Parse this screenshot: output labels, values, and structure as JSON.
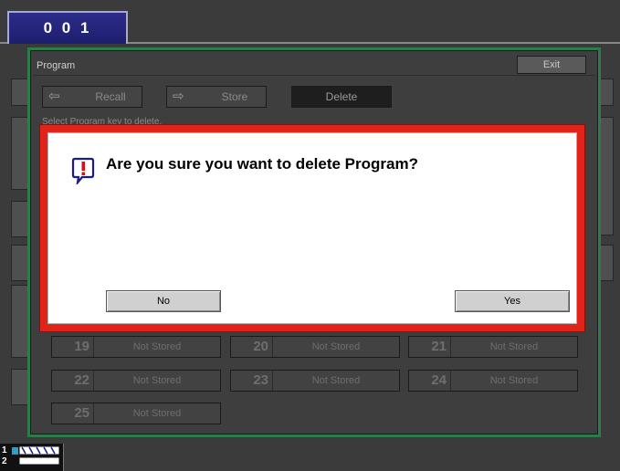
{
  "tab": {
    "label": "0 0 1"
  },
  "program_window": {
    "title": "Program",
    "exit_label": "Exit",
    "toolbar": {
      "recall_label": "Recall",
      "store_label": "Store",
      "delete_label": "Delete"
    },
    "select_label": "Select Program key to delete."
  },
  "slots": [
    {
      "number": "19",
      "status": "Not Stored"
    },
    {
      "number": "20",
      "status": "Not Stored"
    },
    {
      "number": "21",
      "status": "Not Stored"
    },
    {
      "number": "22",
      "status": "Not Stored"
    },
    {
      "number": "23",
      "status": "Not Stored"
    },
    {
      "number": "24",
      "status": "Not Stored"
    },
    {
      "number": "25",
      "status": "Not Stored"
    }
  ],
  "dialog": {
    "message": "Are you sure you want to delete Program?",
    "icon": "warning-icon",
    "no_label": "No",
    "yes_label": "Yes",
    "border_color": "#e2231a"
  },
  "status": {
    "line1": "1",
    "line2": "2"
  }
}
